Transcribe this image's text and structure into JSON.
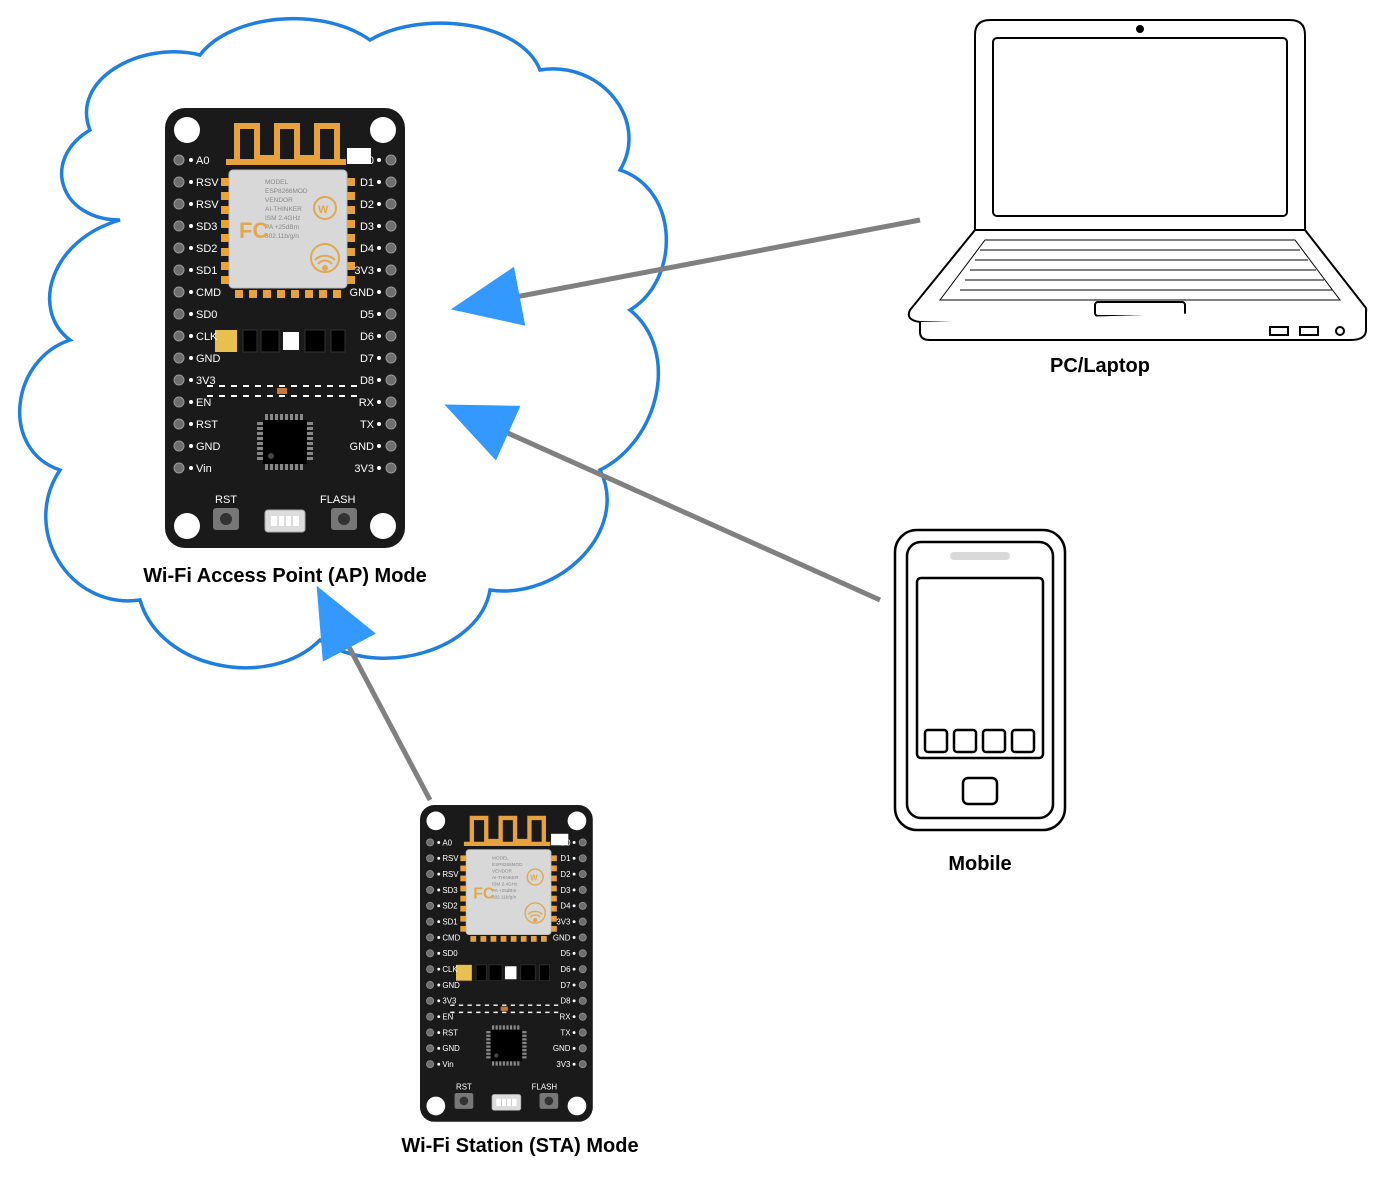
{
  "captions": {
    "ap_mode": "Wi-Fi Access Point (AP) Mode",
    "sta_mode": "Wi-Fi Station (STA) Mode",
    "laptop": "PC/Laptop",
    "mobile": "Mobile"
  },
  "board": {
    "left_pins": [
      "A0",
      "RSV",
      "RSV",
      "SD3",
      "SD2",
      "SD1",
      "CMD",
      "SD0",
      "CLK",
      "GND",
      "3V3",
      "EN",
      "RST",
      "GND",
      "Vin"
    ],
    "right_pins": [
      "D0",
      "D1",
      "D2",
      "D3",
      "D4",
      "3V3",
      "GND",
      "D5",
      "D6",
      "D7",
      "D8",
      "RX",
      "TX",
      "GND",
      "3V3"
    ],
    "btn_left": "RST",
    "btn_right": "FLASH",
    "chip_lines": [
      "MODEL",
      "ESP8266MOD",
      "VENDOR",
      "AI-THINKER",
      "ISM 2.4GHz",
      "PA +25dBm",
      "802.11b/g/n"
    ]
  },
  "colors": {
    "cloud": "#1e7fe0",
    "arrow_line": "#808080",
    "arrow_head": "#3399ff",
    "pcb": "#1a1a1a",
    "copper": "#e8a23d",
    "silver": "#d8d8d8",
    "pin_text": "#ffffff"
  }
}
